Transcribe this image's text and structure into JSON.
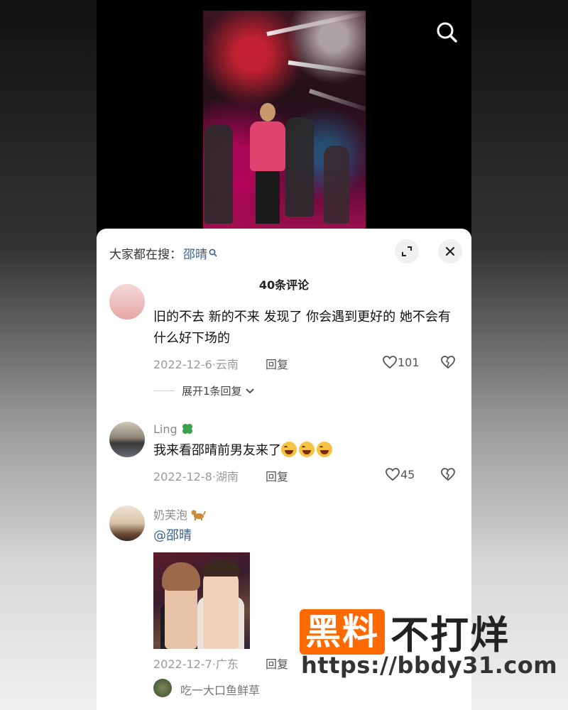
{
  "video": {},
  "panel": {
    "hot_search_prefix": "大家都在搜：",
    "hot_search_term": "邵晴",
    "comment_count": "40条评论"
  },
  "comments": [
    {
      "text": "旧的不去 新的不来 发现了 你会遇到更好的 她不会有什么好下场的",
      "meta": "2022-12-6·云南",
      "reply_label": "回复",
      "likes": "101",
      "expand_label": "展开1条回复"
    },
    {
      "name": "Ling",
      "name_icon": "clover-icon",
      "text": "我来看邵晴前男友来了",
      "emoji_count": 3,
      "meta": "2022-12-8·湖南",
      "reply_label": "回复",
      "likes": "45"
    },
    {
      "name": "奶芙泡",
      "name_icon": "dog-icon",
      "text": "@邵晴",
      "meta": "2022-12-7·广东",
      "reply_label": "回复"
    },
    {
      "name": "吃一大口鱼鲜草"
    }
  ],
  "watermark": {
    "brand_box": "黑料",
    "brand_rest": "不打烊",
    "url": "https://bbdy31.com"
  },
  "colors": {
    "accent_link": "#3b5f8f",
    "brand_orange": "#ff6a00"
  }
}
